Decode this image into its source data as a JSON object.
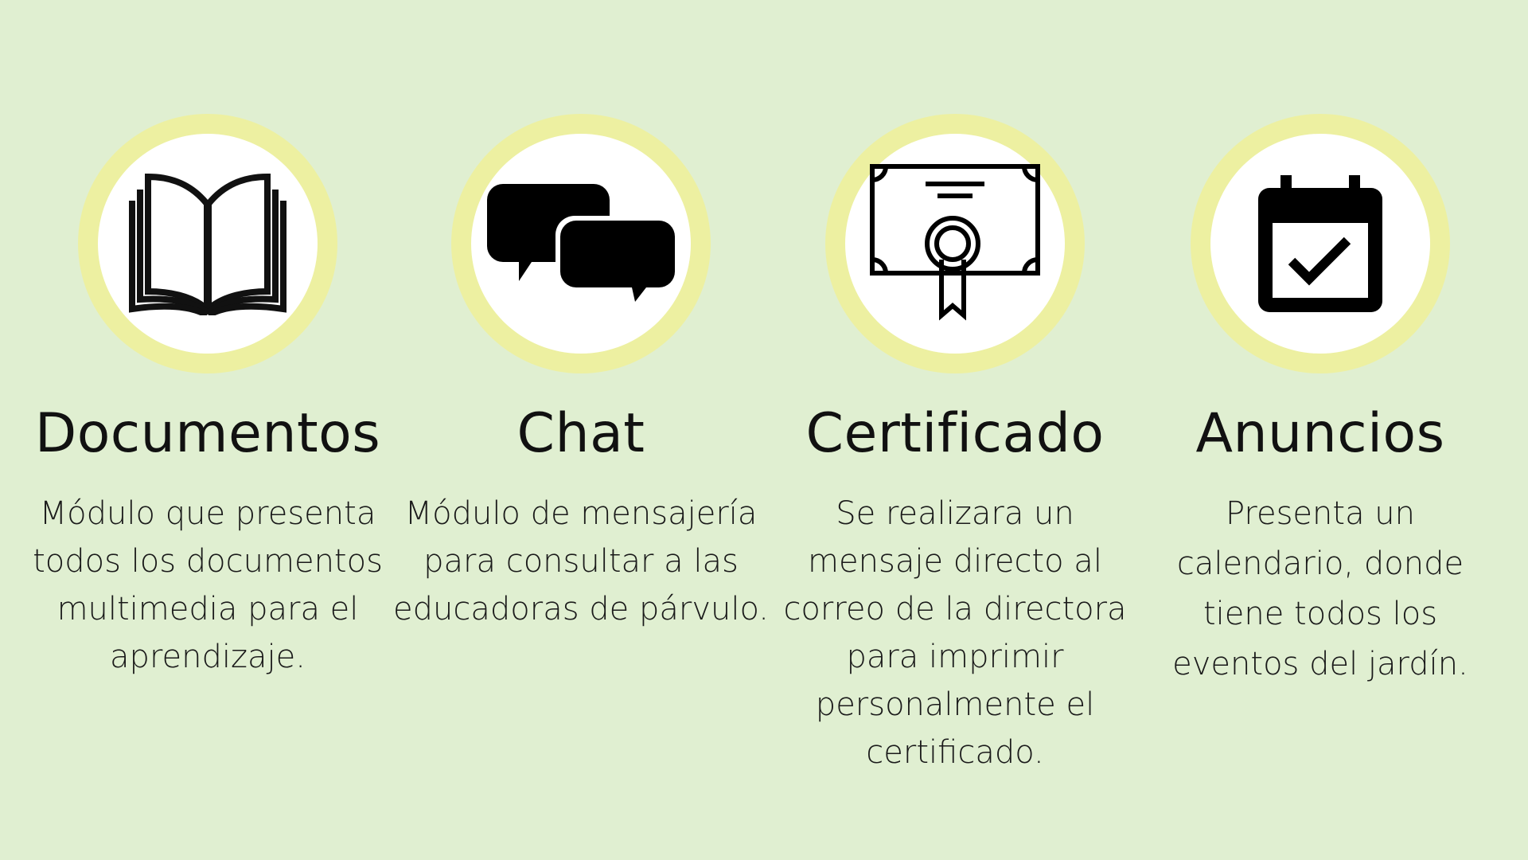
{
  "colors": {
    "background": "#e0efd1",
    "ring": "#edf0a1",
    "icon": "#000000"
  },
  "features": [
    {
      "icon": "open-book-icon",
      "title": "Documentos",
      "lines": [
        "Módulo que presenta",
        "todos los documentos",
        "multimedia para el",
        "aprendizaje."
      ]
    },
    {
      "icon": "chat-bubbles-icon",
      "title": "Chat",
      "lines": [
        "Módulo de mensajería",
        "para consultar a las",
        "educadoras de párvulo."
      ]
    },
    {
      "icon": "certificate-icon",
      "title": "Certificado",
      "lines": [
        "Se realizara un",
        "mensaje directo al",
        "correo de la directora",
        "para imprimir",
        "personalmente el",
        "certificado."
      ]
    },
    {
      "icon": "calendar-check-icon",
      "title": "Anuncios",
      "lines": [
        "Presenta un",
        "calendario, donde",
        "tiene todos los",
        "eventos del jardín."
      ]
    }
  ]
}
